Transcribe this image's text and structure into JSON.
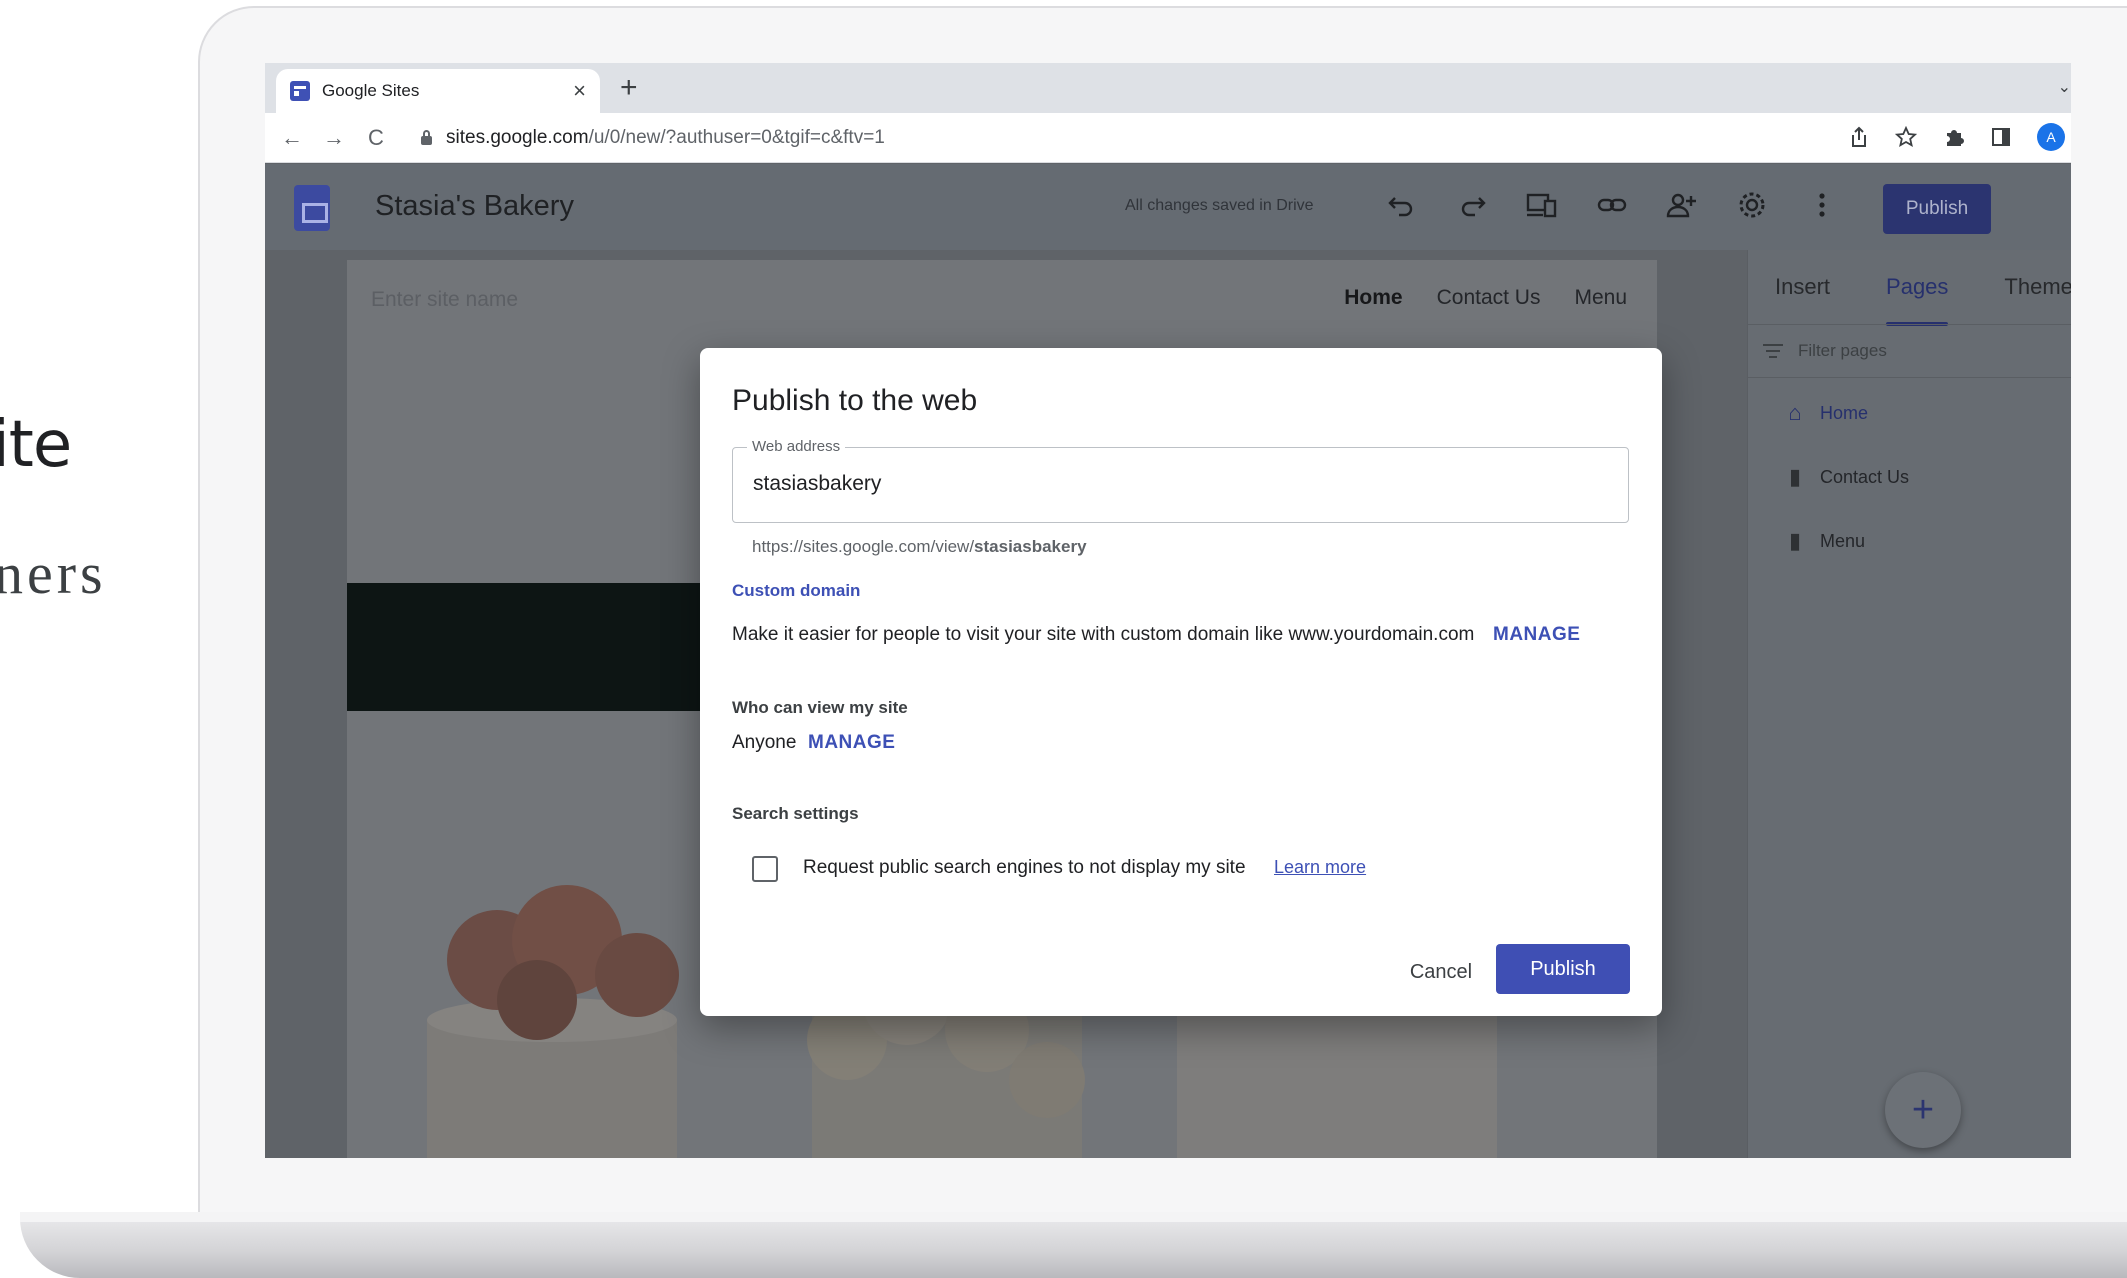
{
  "slide": {
    "title_fragment": "ite",
    "subtitle_fragment": "ners"
  },
  "browser": {
    "tab_title": "Google Sites",
    "tab_close": "×",
    "new_tab": "+",
    "tab_menu": "⌄",
    "nav": {
      "back": "←",
      "forward": "→",
      "reload": "C"
    },
    "url_host": "sites.google.com",
    "url_path": "/u/0/new/?authuser=0&tgif=c&ftv=1",
    "toolbar_icons": [
      "share-icon",
      "star-icon",
      "extension-icon",
      "sidepanel-icon"
    ],
    "avatar_letter": "A"
  },
  "app": {
    "title": "Stasia's Bakery",
    "saved_status": "All changes saved in Drive",
    "icons": [
      "undo-icon",
      "redo-icon",
      "preview-icon",
      "link-icon",
      "share-icon",
      "settings-icon",
      "more-icon"
    ],
    "publish_label": "Publish"
  },
  "site": {
    "name_placeholder": "Enter site name",
    "nav": [
      "Home",
      "Contact Us",
      "Menu"
    ]
  },
  "right_panel": {
    "tabs": [
      "Insert",
      "Pages",
      "Theme"
    ],
    "active_tab": "Pages",
    "filter_placeholder": "Filter pages",
    "pages": [
      {
        "label": "Home",
        "icon": "home-icon"
      },
      {
        "label": "Contact Us",
        "icon": "page-icon"
      },
      {
        "label": "Menu",
        "icon": "page-icon"
      }
    ],
    "fab_label": "+"
  },
  "dialog": {
    "title": "Publish to the web",
    "web_address_label": "Web address",
    "web_address_value": "stasiasbakery",
    "url_prefix": "https://sites.google.com/view/",
    "url_slug": "stasiasbakery",
    "custom_domain_label": "Custom domain",
    "custom_domain_text": "Make it easier for people to visit your site with custom domain like www.yourdomain.com",
    "custom_domain_manage": "MANAGE",
    "who_can_view_label": "Who can view my site",
    "who_can_view_value": "Anyone",
    "who_can_view_manage": "MANAGE",
    "search_settings_label": "Search settings",
    "search_checkbox_label": "Request public search engines to not display my site",
    "search_checkbox_checked": false,
    "learn_more": "Learn more",
    "cancel_label": "Cancel",
    "publish_label": "Publish"
  },
  "colors": {
    "accent": "#3f4fb4",
    "link": "#3d50b5",
    "hero_band": "#0d1514"
  }
}
